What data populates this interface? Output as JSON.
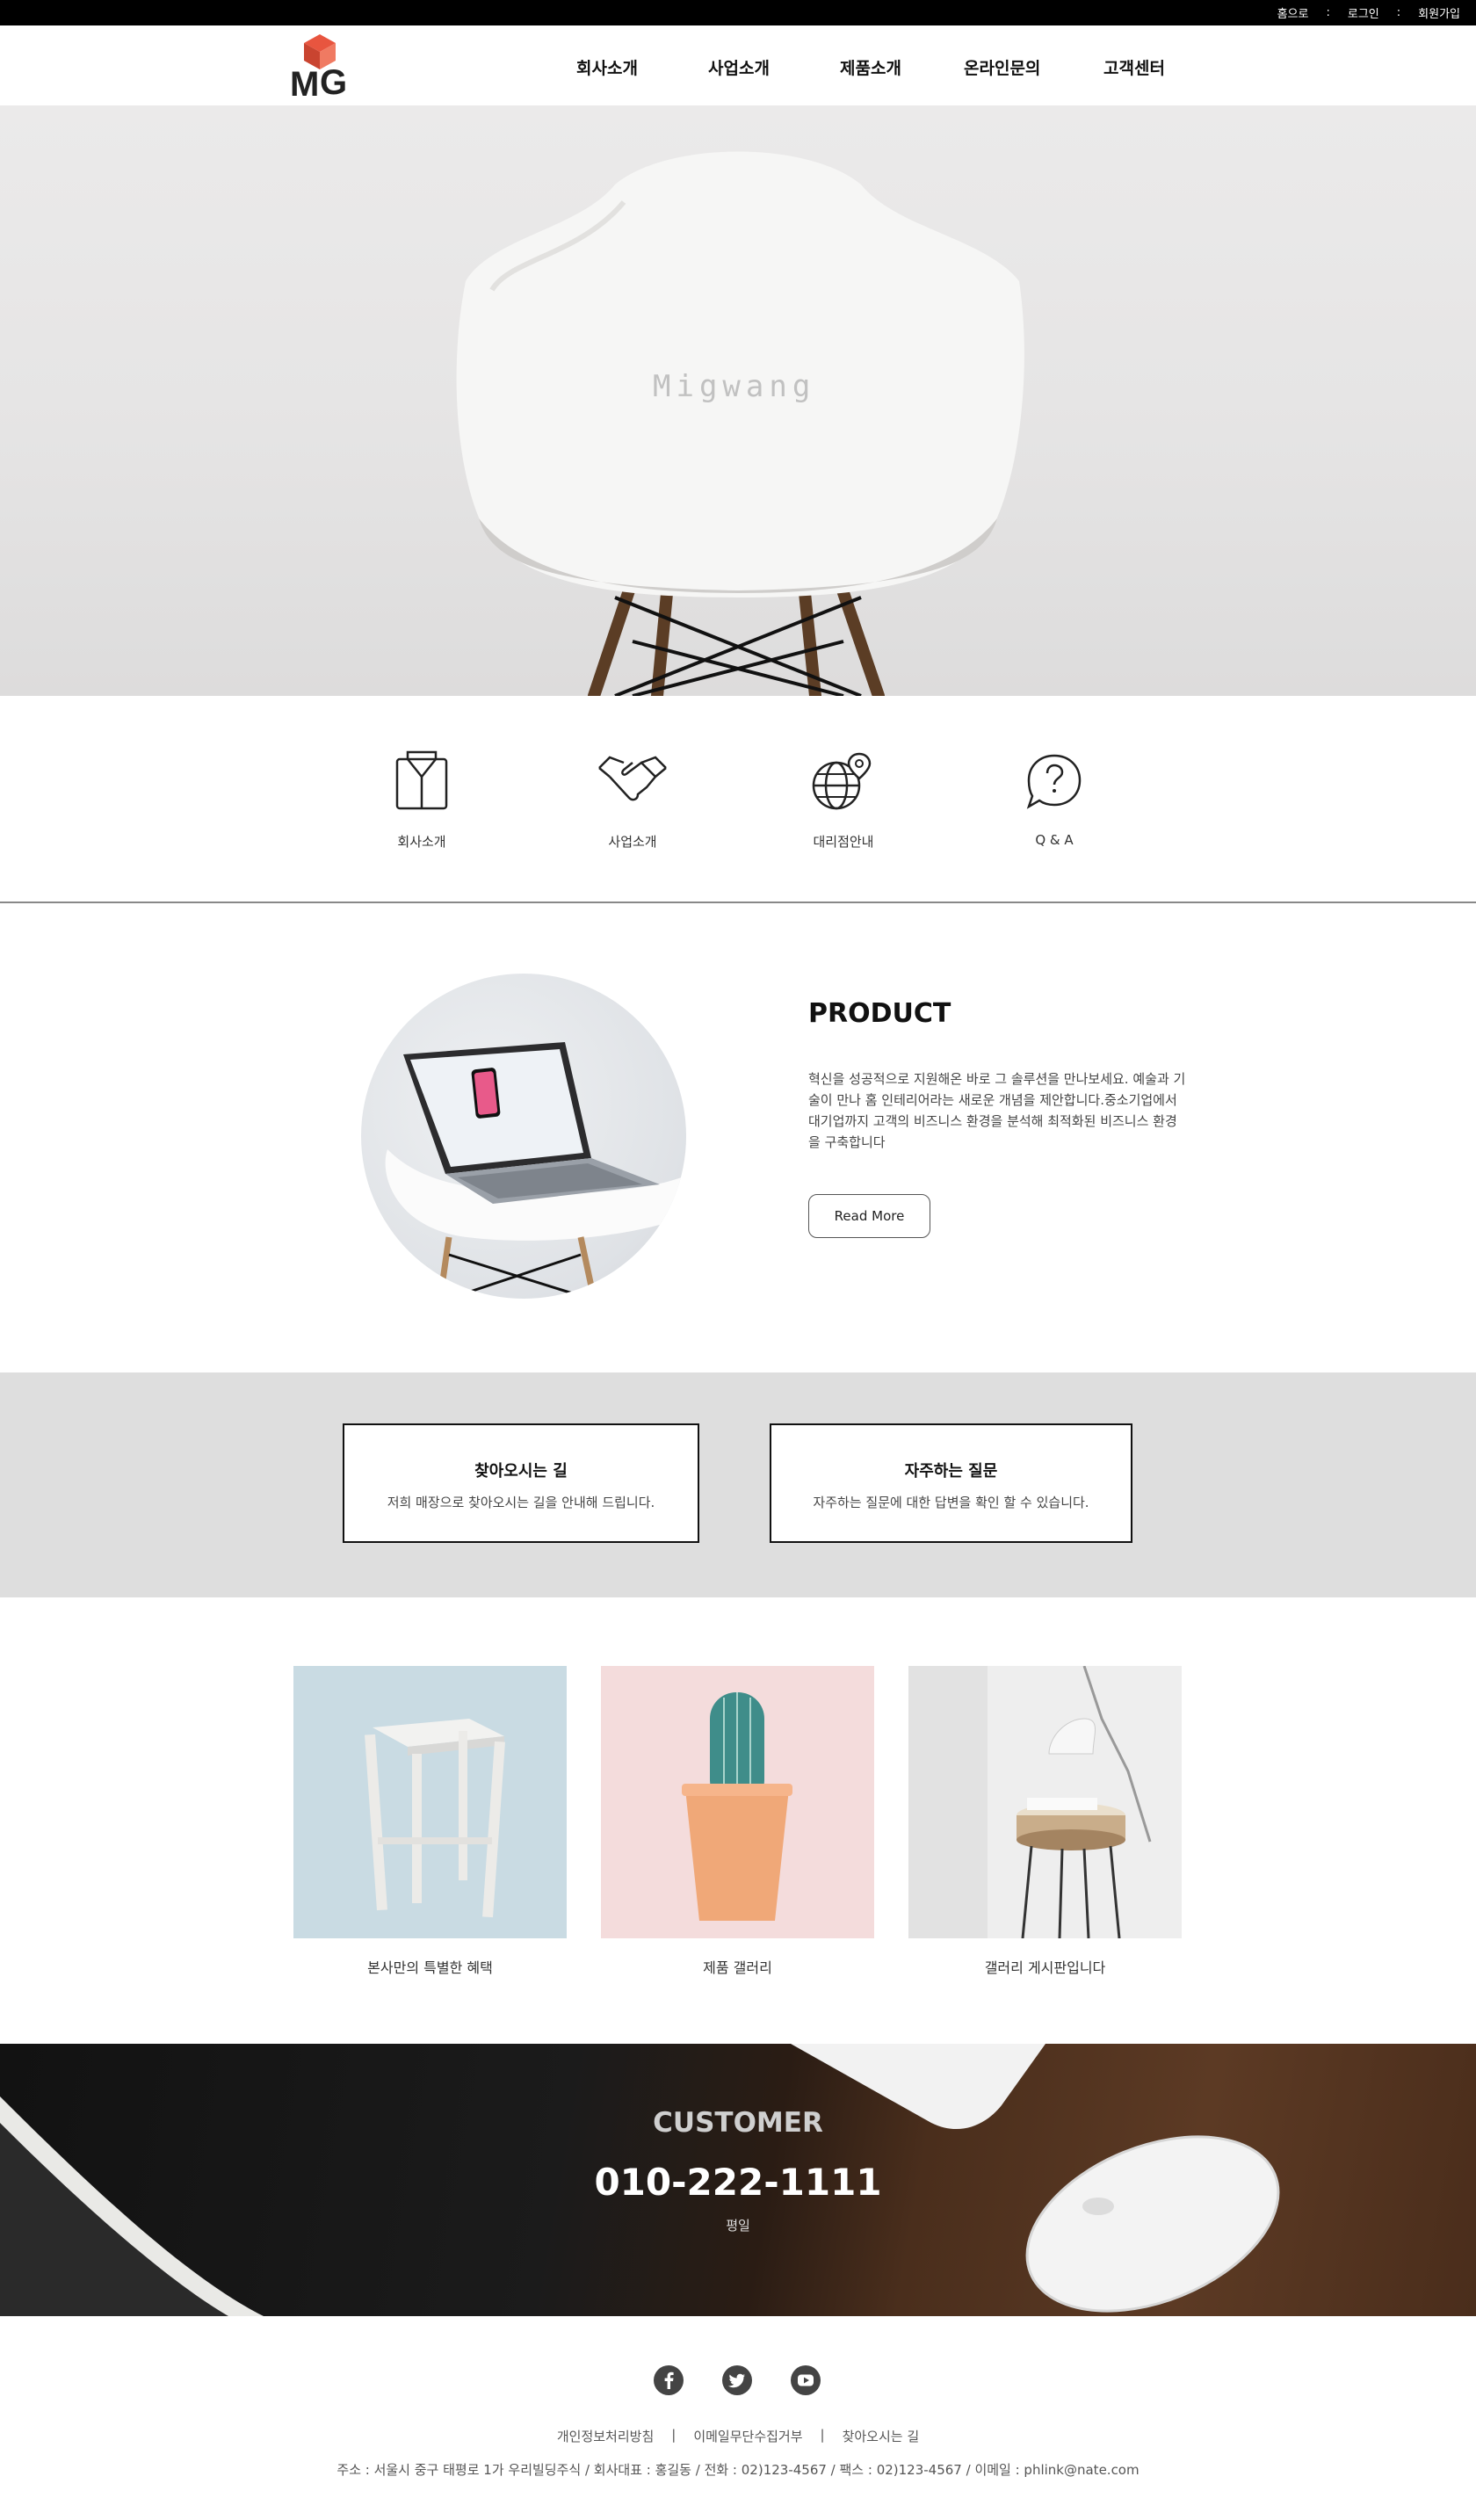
{
  "topbar": {
    "links": [
      "홈으로",
      "로그인",
      "회원가입"
    ],
    "separator": ":"
  },
  "header": {
    "logo_text": "MG",
    "nav": [
      "회사소개",
      "사업소개",
      "제품소개",
      "온라인문의",
      "고객센터"
    ]
  },
  "hero": {
    "watermark": "Migwang"
  },
  "quick_links": [
    {
      "label": "회사소개",
      "icon": "shirt-box-icon"
    },
    {
      "label": "사업소개",
      "icon": "handshake-icon"
    },
    {
      "label": "대리점안내",
      "icon": "globe-pin-icon"
    },
    {
      "label": "Q & A",
      "icon": "question-bubble-icon"
    }
  ],
  "product": {
    "title": "PRODUCT",
    "description": "혁신을 성공적으로 지원해온 바로 그 솔루션을 만나보세요. 예술과 기술이 만나 홈 인테리어라는 새로운 개념을 제안합니다.중소기업에서 대기업까지 고객의 비즈니스 환경을 분석해 최적화된 비즈니스 환경을 구축합니다",
    "button": "Read More"
  },
  "info_boxes": [
    {
      "title": "찾아오시는 길",
      "desc": "저희 매장으로 찾아오시는 길을 안내해 드립니다."
    },
    {
      "title": "자주하는 질문",
      "desc": "자주하는 질문에 대한 답변을 확인 할 수 있습니다."
    }
  ],
  "gallery": [
    {
      "caption": "본사만의 특별한 혜택"
    },
    {
      "caption": "제품 갤러리"
    },
    {
      "caption": "갤러리 게시판입니다"
    }
  ],
  "customer": {
    "title": "CUSTOMER",
    "phone": "010-222-1111",
    "note": "평일"
  },
  "footer": {
    "social": [
      "facebook-icon",
      "twitter-icon",
      "youtube-icon"
    ],
    "links": [
      "개인정보처리방침",
      "이메일무단수집거부",
      "찾아오시는 길"
    ],
    "link_separator": "|",
    "address": "주소 : 서울시 중구 태평로 1가 우리빌딩주식 / 회사대표 : 홍길동 / 전화 : 02)123-4567 / 팩스 : 02)123-4567 / 이메일 : phlink@nate.com"
  },
  "colors": {
    "topbar": "#000000",
    "band_gray": "#dedede",
    "logo_accent": "#e8553f"
  }
}
